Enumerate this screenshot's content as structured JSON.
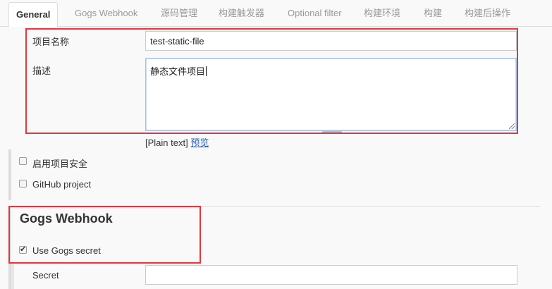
{
  "tabs": [
    {
      "label": "General"
    },
    {
      "label": "Gogs Webhook"
    },
    {
      "label": "源码管理"
    },
    {
      "label": "构建触发器"
    },
    {
      "label": "Optional filter"
    },
    {
      "label": "构建环境"
    },
    {
      "label": "构建"
    },
    {
      "label": "构建后操作"
    }
  ],
  "general": {
    "project_name_label": "项目名称",
    "project_name_value": "test-static-file",
    "description_label": "描述",
    "description_value": "静态文件项目",
    "plain_text": "[Plain text]",
    "preview_link": "预览",
    "enable_security_label": "启用项目安全",
    "github_project_label": "GitHub project"
  },
  "gogs": {
    "section_title": "Gogs Webhook",
    "use_secret_label": "Use Gogs secret",
    "use_secret_checked": true,
    "secret_label": "Secret",
    "secret_value": ""
  },
  "colors": {
    "highlight_border": "#e0383e",
    "link": "#2a5db0"
  }
}
